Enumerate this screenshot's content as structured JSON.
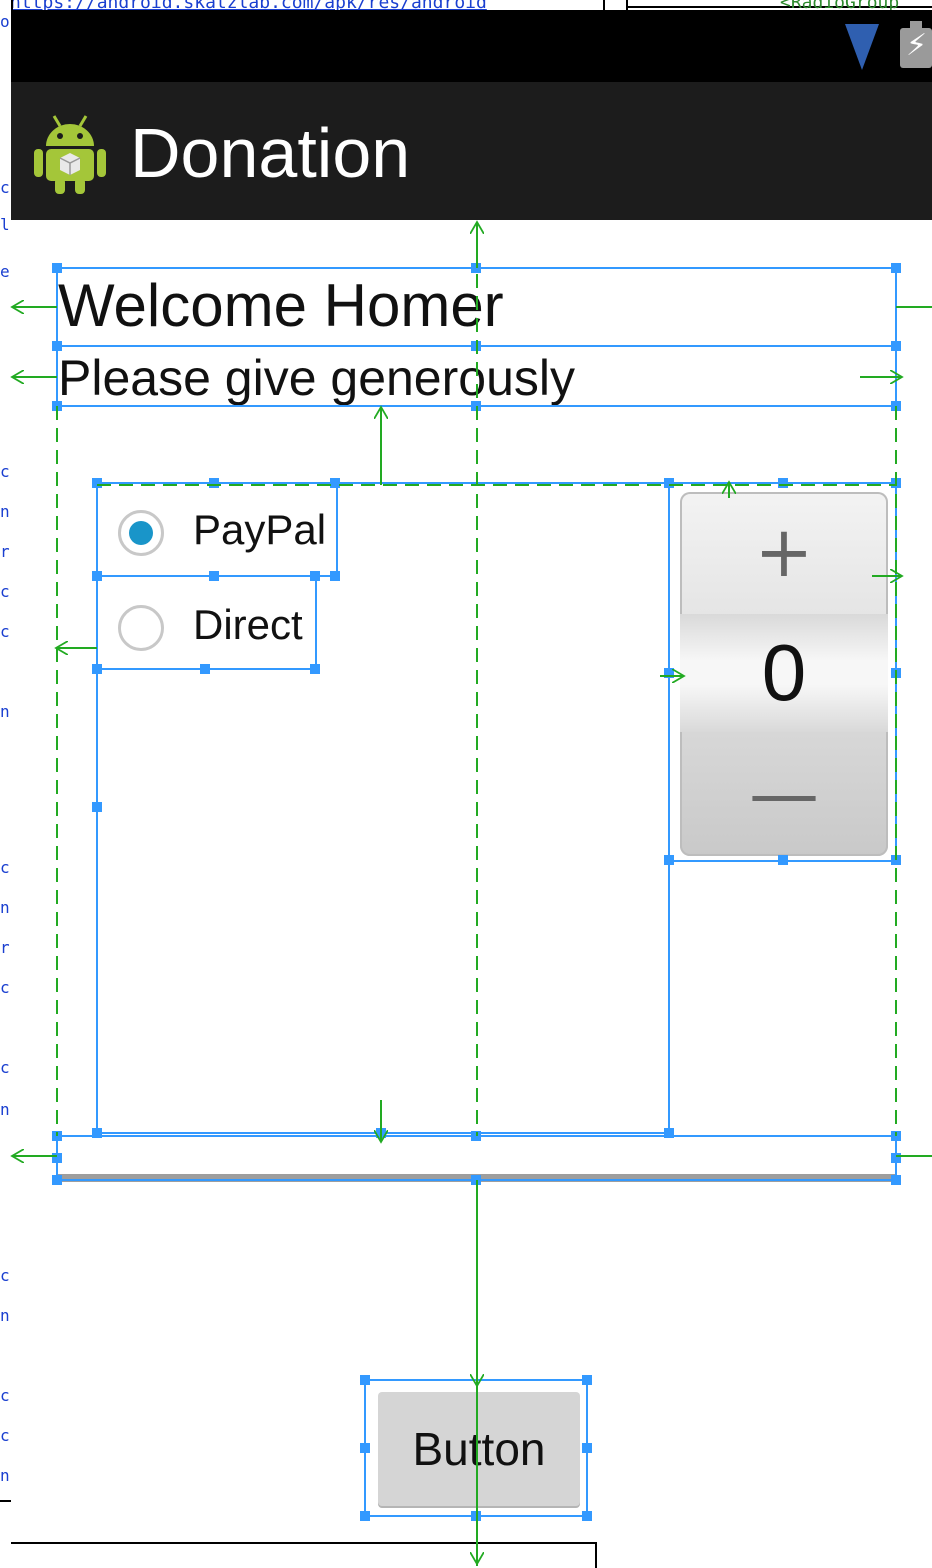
{
  "topstrip": {
    "url": "https://android.skatzlab.com/apk/res/android",
    "tag": "<RadioGroup"
  },
  "app": {
    "title": "Donation"
  },
  "main": {
    "welcome": "Welcome Homer",
    "subtitle": "Please give generously",
    "radios": [
      {
        "label": "PayPal",
        "checked": true
      },
      {
        "label": "Direct",
        "checked": false
      }
    ],
    "picker": {
      "increment": "+",
      "value": "0",
      "decrement": "—"
    },
    "button": "Button"
  },
  "icons": {
    "app": "android-icon",
    "signal": "signal-icon",
    "battery": "battery-icon"
  },
  "colors": {
    "selection": "#3399ff",
    "guide": "#22aa22",
    "radio_checked": "#1995c9",
    "actionbar": "#1c1c1c"
  }
}
